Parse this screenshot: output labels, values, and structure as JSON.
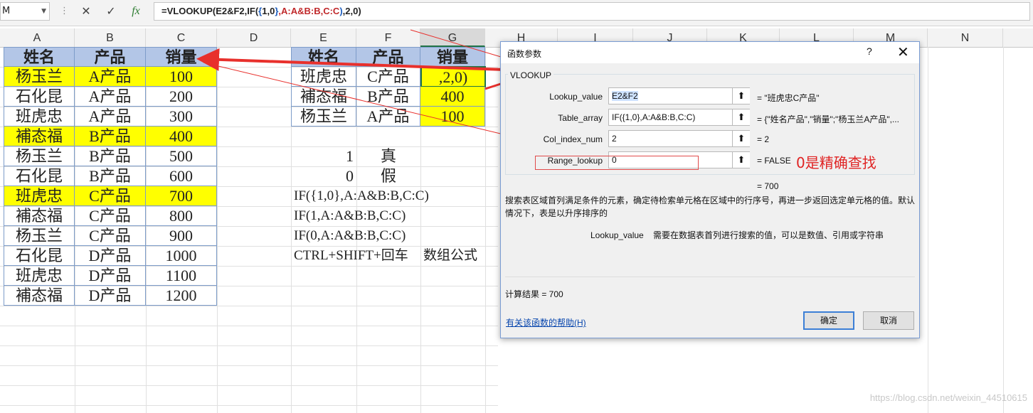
{
  "formula_bar": {
    "name_box": "M",
    "cancel": "✕",
    "enter": "✓",
    "fx": "fx",
    "formula_parts": [
      "=VLOOKUP(E2&F2,IF(",
      "{",
      "1,0",
      "}",
      ",A:A&B:B,C:C",
      ")",
      ",2,0)"
    ]
  },
  "columns": [
    "A",
    "B",
    "C",
    "D",
    "E",
    "F",
    "G",
    "H",
    "I",
    "J",
    "K",
    "L",
    "M",
    "N"
  ],
  "left_table": {
    "headers": [
      "姓名",
      "产品",
      "销量"
    ],
    "rows": [
      {
        "name": "杨玉兰",
        "product": "A产品",
        "qty": "100",
        "highlight": true
      },
      {
        "name": "石化昆",
        "product": "A产品",
        "qty": "200",
        "highlight": false
      },
      {
        "name": "班虎忠",
        "product": "A产品",
        "qty": "300",
        "highlight": false
      },
      {
        "name": "補态福",
        "product": "B产品",
        "qty": "400",
        "highlight": true
      },
      {
        "name": "杨玉兰",
        "product": "B产品",
        "qty": "500",
        "highlight": false
      },
      {
        "name": "石化昆",
        "product": "B产品",
        "qty": "600",
        "highlight": false
      },
      {
        "name": "班虎忠",
        "product": "C产品",
        "qty": "700",
        "highlight": true
      },
      {
        "name": "補态福",
        "product": "C产品",
        "qty": "800",
        "highlight": false
      },
      {
        "name": "杨玉兰",
        "product": "C产品",
        "qty": "900",
        "highlight": false
      },
      {
        "name": "石化昆",
        "product": "D产品",
        "qty": "1000",
        "highlight": false
      },
      {
        "name": "班虎忠",
        "product": "D产品",
        "qty": "1100",
        "highlight": false
      },
      {
        "name": "補态福",
        "product": "D产品",
        "qty": "1200",
        "highlight": false
      }
    ]
  },
  "right_table": {
    "headers": [
      "姓名",
      "产品",
      "销量"
    ],
    "rows": [
      {
        "name": "班虎忠",
        "product": "C产品",
        "qty": ",2,0)"
      },
      {
        "name": "補态福",
        "product": "B产品",
        "qty": "400"
      },
      {
        "name": "杨玉兰",
        "product": "A产品",
        "qty": "100"
      }
    ]
  },
  "notes": {
    "one": "1",
    "true_label": "真",
    "zero": "0",
    "false_label": "假",
    "line1": "IF({1,0},A:A&B:B,C:C)",
    "line2": "IF(1,A:A&B:B,C:C)",
    "line3": "IF(0,A:A&B:B,C:C)",
    "line4a": "CTRL+SHIFT+回车",
    "line4b": "数组公式"
  },
  "dialog": {
    "title": "函数参数",
    "help_glyph": "?",
    "close_glyph": "✕",
    "func": "VLOOKUP",
    "params": [
      {
        "label": "Lookup_value",
        "value": "E2&F2",
        "result": "=   \"班虎忠C产品\""
      },
      {
        "label": "Table_array",
        "value": "IF({1,0},A:A&B:B,C:C)",
        "result": "=   {\"姓名产品\",\"销量\";\"杨玉兰A产品\",..."
      },
      {
        "label": "Col_index_num",
        "value": "2",
        "result": "=   2"
      },
      {
        "label": "Range_lookup",
        "value": "0",
        "result": "=   FALSE"
      }
    ],
    "annotation": "0是精确查找",
    "total": "=   700",
    "description": "搜索表区域首列满足条件的元素，确定待检索单元格在区域中的行序号，再进一步返回选定单元格的值。默认情况下，表是以升序排序的",
    "param_help_label": "Lookup_value",
    "param_help_text": "需要在数据表首列进行搜索的值，可以是数值、引用或字符串",
    "calc_result": "计算结果 =   700",
    "help_link": "有关该函数的帮助(H)",
    "ok": "确定",
    "cancel": "取消"
  },
  "watermark": "https://blog.csdn.net/weixin_44510615",
  "colors": {
    "header_fill": "#b3c6e7",
    "highlight": "#ffff00",
    "arrow": "#e8302c"
  }
}
